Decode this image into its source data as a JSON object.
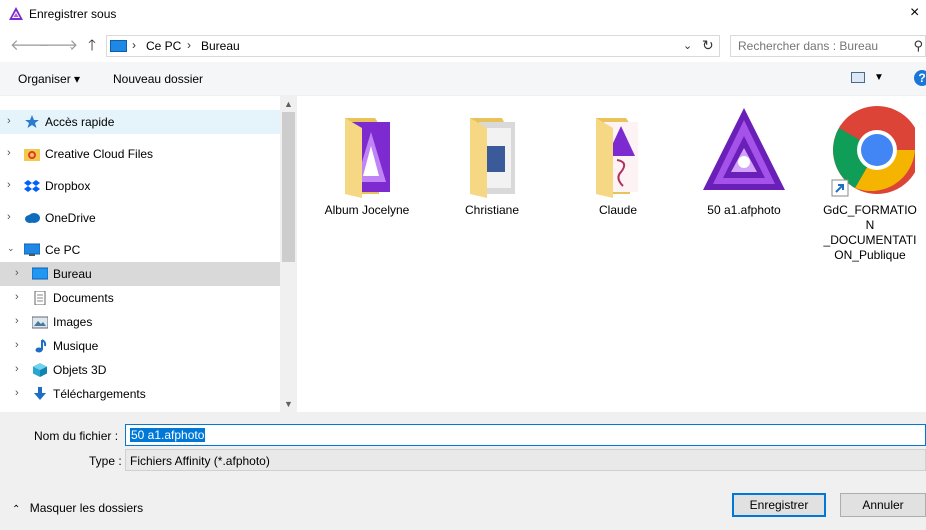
{
  "window": {
    "title": "Enregistrer sous",
    "close_glyph": "×"
  },
  "nav": {
    "back_icon": "arrow-left-icon",
    "forward_icon": "arrow-right-icon",
    "recent_icon": "chevron-down-icon",
    "up_icon": "arrow-up-icon"
  },
  "address": {
    "crumbs": [
      "Ce PC",
      "Bureau"
    ]
  },
  "search": {
    "placeholder": "Rechercher dans : Bureau"
  },
  "toolbar": {
    "organize": "Organiser ▾",
    "new_folder": "Nouveau dossier"
  },
  "sidebar": {
    "items": [
      {
        "label": "Accès rapide",
        "icon": "star-icon"
      },
      {
        "label": "Creative Cloud Files",
        "icon": "creative-cloud-folder-icon"
      },
      {
        "label": "Dropbox",
        "icon": "dropbox-icon"
      },
      {
        "label": "OneDrive",
        "icon": "cloud-icon"
      },
      {
        "label": "Ce PC",
        "icon": "computer-icon"
      },
      {
        "label": "Bureau",
        "icon": "desktop-icon"
      },
      {
        "label": "Documents",
        "icon": "document-icon"
      },
      {
        "label": "Images",
        "icon": "images-icon"
      },
      {
        "label": "Musique",
        "icon": "music-icon"
      },
      {
        "label": "Objets 3D",
        "icon": "cube-icon"
      },
      {
        "label": "Téléchargements",
        "icon": "download-icon"
      }
    ]
  },
  "files": [
    {
      "name": "Album Jocelyne",
      "icon": "affinity-folder-icon"
    },
    {
      "name": "Christiane",
      "icon": "document-folder-icon"
    },
    {
      "name": "Claude",
      "icon": "monogram-folder-icon"
    },
    {
      "name": "50 a1.afphoto",
      "icon": "affinity-photo-icon"
    },
    {
      "name_lines": [
        "GdC_FORMATIO",
        "N",
        "_DOCUMENTATI",
        "ON_Publique"
      ],
      "icon": "chrome-shortcut-icon"
    }
  ],
  "form": {
    "filename_label": "Nom du fichier :",
    "filename_value": "50 a1.afphoto",
    "type_label": "Type :",
    "type_value": "Fichiers Affinity (*.afphoto)"
  },
  "footer": {
    "hide_folders": "Masquer les dossiers",
    "save": "Enregistrer",
    "cancel": "Annuler"
  },
  "colors": {
    "accent": "#0078d7",
    "hover": "#e5f3fb",
    "selected": "#d9d9d9",
    "affinity_purple": "#7d2bd1"
  }
}
